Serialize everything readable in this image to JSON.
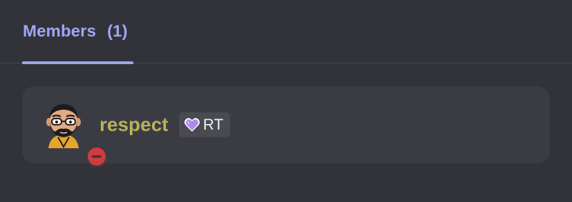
{
  "tabs": [
    {
      "label": "Members",
      "count": "(1)",
      "active": true
    }
  ],
  "members": [
    {
      "name": "respect",
      "name_color": "#b9b15a",
      "status": "do-not-disturb",
      "status_color": "#d23a40",
      "avatar_icon": "bearded-man-with-glasses-avatar",
      "role_tag": {
        "icon": "purple-heart-icon",
        "label": "RT"
      }
    }
  ],
  "colors": {
    "background": "#323339",
    "card": "#3b3c43",
    "accent": "#9ea6f5",
    "role_heart": "#a98cf0"
  }
}
